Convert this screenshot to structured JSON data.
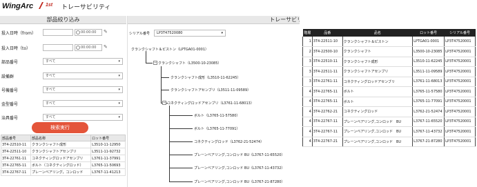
{
  "header": {
    "logo_text": "WingArc",
    "logo_suffix": "1st",
    "title": "トレーサビリティ"
  },
  "left": {
    "title": "部品絞り込み",
    "dates": [
      {
        "label": "投入日時（from）",
        "time": "00:00:00"
      },
      {
        "label": "投入日時（to）",
        "time": "00:00:00"
      }
    ],
    "filters": [
      {
        "label": "部品番号",
        "value": "すべて"
      },
      {
        "label": "設備群",
        "value": "すべて"
      },
      {
        "label": "号機番号",
        "value": "すべて"
      },
      {
        "label": "金型番号",
        "value": "すべて"
      },
      {
        "label": "治具番号",
        "value": "すべて"
      }
    ],
    "search_label": "検索実行",
    "table": {
      "headers": [
        "部品番号",
        "部品名称",
        "ロット番号"
      ],
      "rows": [
        [
          "3T4-22510-11",
          "クランクシャフト成形",
          "L3510-11-12950"
        ],
        [
          "3T4-22511-10",
          "クランクシャフトアセンブリ",
          "L3511-11-92732"
        ],
        [
          "3T4-22761-11",
          "コネクティングロッドアセンブリ",
          "L3761-11-37991"
        ],
        [
          "3T4-22765-11",
          "ボルト（コネクティングロッド）",
          "L3765-11-50693"
        ],
        [
          "3T4-22767-11",
          "プレーンベアリング，コンロッド",
          "L3767-11-41213"
        ]
      ]
    }
  },
  "middle": {
    "title": "トレーサビリティ情報表示",
    "serial_label": "シリアル番号",
    "serial_value": "LP3T47520080",
    "tree": [
      "クランクシャフト＆ピストン（LPTGA01-0001）",
      "クランクシャフト（L3500-10-23085）",
      "クランクシャフト成形（L3510-11-62245）",
      "クランクシャフトアセンブリ（L3511-11-09589）",
      "コネクティングロッドアセンブリ（L3761-11-68013）",
      "ボルト（L3765-11-57580）",
      "ボルト（L3765-11-77091）",
      "コネクティングロッド（L3762-21-52474）",
      "プレーンベアリング,コンロッド BU（L3767-11-65520）",
      "プレーンベアリング,コンロッド BU（L3767-11-43732）",
      "プレーンベアリング,コンロッド BU（L3767-21-87280）"
    ]
  },
  "right": {
    "headers": [
      "階層",
      "品番",
      "品名",
      "ロット番号",
      "シリアル番号"
    ],
    "rows": [
      [
        "1",
        "3T4-22511-10",
        "クランクシャフト＆ピストン",
        "LPTGA01-0001",
        "LP3T47520001"
      ],
      [
        "2",
        "3T4-22500-10",
        "クランクシャフト",
        "L3500-10-23085",
        "LP3T47520001"
      ],
      [
        "3",
        "3T4-22510-11",
        "クランクシャフト成形",
        "L3510-11-62245",
        "LP3T47520001"
      ],
      [
        "3",
        "3T4-22511-11",
        "クランクシャフトアセンブリ",
        "L3511-11-09589",
        "LP3T47520001"
      ],
      [
        "3",
        "3T4-22761-11",
        "コネクティングロッドアセンブリ",
        "L3761-11-68013",
        "LP3T47520001"
      ],
      [
        "4",
        "3T4-22765-11",
        "ボルト",
        "L3765-11-57580",
        "LP3T47520001"
      ],
      [
        "4",
        "3T4-22765-11",
        "ボルト",
        "L3765-11-77091",
        "LP3T47520001"
      ],
      [
        "4",
        "3T4-22762-21",
        "コネクティングロッド",
        "L3762-21-52474",
        "LP3T47520001"
      ],
      [
        "4",
        "3T4-22767-11",
        "プレーンベアリング,コンロッド　BU",
        "L3767-11-65520",
        "LP3T47520001"
      ],
      [
        "4",
        "3T4-22767-11",
        "プレーンベアリング,コンロッド　BU",
        "L3767-11-43732",
        "LP3T47520001"
      ],
      [
        "4",
        "3T4-22767-21",
        "プレーンベアリング,コンロッド　BU",
        "L3767-21-87280",
        "LP3T47520001"
      ]
    ]
  },
  "colors": {
    "accent": "#e4553a",
    "header_dark": "#222222",
    "panel_header": "#e8e8e8"
  }
}
